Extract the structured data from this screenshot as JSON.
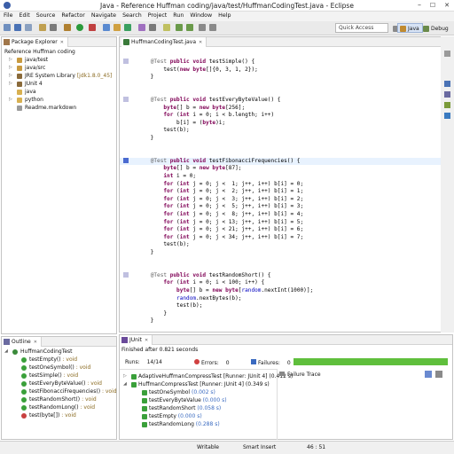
{
  "window": {
    "title": "Java - Reference Huffman coding/java/test/HuffmanCodingTest.java - Eclipse",
    "minimize": "–",
    "maximize": "☐",
    "close": "✕"
  },
  "menu": [
    "File",
    "Edit",
    "Source",
    "Refactor",
    "Navigate",
    "Search",
    "Project",
    "Run",
    "Window",
    "Help"
  ],
  "toolbar": {
    "quick_access": "Quick Access",
    "perspectives": [
      "Java",
      "Debug"
    ]
  },
  "package_explorer": {
    "tab": "Package Explorer",
    "project": "Reference Huffman coding",
    "items": [
      {
        "label": "java/test",
        "icon": "source-folder-icon",
        "arrow": "▷"
      },
      {
        "label": "java/src",
        "icon": "source-folder-icon",
        "arrow": "▷"
      },
      {
        "label": "JRE System Library",
        "suffix": "[jdk1.8.0_45]",
        "icon": "library-icon",
        "arrow": "▷"
      },
      {
        "label": "JUnit 4",
        "icon": "library-icon",
        "arrow": "▷"
      },
      {
        "label": "java",
        "icon": "folder-icon",
        "arrow": ""
      },
      {
        "label": "python",
        "icon": "folder-icon",
        "arrow": "▷"
      },
      {
        "label": "Readme.markdown",
        "icon": "file-icon",
        "arrow": ""
      }
    ]
  },
  "editor": {
    "tab": "HuffmanCodingTest.java",
    "lines": [
      "    @Test public void testSimple() {",
      "        test(new byte[]{0, 3, 1, 2});",
      "    }",
      "",
      "",
      "    @Test public void testEveryByteValue() {",
      "        byte[] b = new byte[256];",
      "        for (int i = 0; i < b.length; i++)",
      "            b[i] = (byte)i;",
      "        test(b);",
      "    }",
      "",
      "",
      "    @Test public void testFibonacciFrequencies() {",
      "        byte[] b = new byte[87];",
      "        int i = 0;",
      "        for (int j = 0; j <  1; j++, i++) b[i] = 0;",
      "        for (int j = 0; j <  2; j++, i++) b[i] = 1;",
      "        for (int j = 0; j <  3; j++, i++) b[i] = 2;",
      "        for (int j = 0; j <  5; j++, i++) b[i] = 3;",
      "        for (int j = 0; j <  8; j++, i++) b[i] = 4;",
      "        for (int j = 0; j < 13; j++, i++) b[i] = 5;",
      "        for (int j = 0; j < 21; j++, i++) b[i] = 6;",
      "        for (int j = 0; j < 34; j++, i++) b[i] = 7;",
      "        test(b);",
      "    }",
      "",
      "",
      "    @Test public void testRandomShort() {",
      "        for (int i = 0; i < 100; i++) {",
      "            byte[] b = new byte[random.nextInt(1000)];",
      "            random.nextBytes(b);",
      "            test(b);",
      "        }",
      "    }"
    ]
  },
  "outline": {
    "tab": "Outline",
    "class": "HuffmanCodingTest",
    "items": [
      "testEmpty() : void",
      "testOneSymbol() : void",
      "testSimple() : void",
      "testEveryByteValue() : void",
      "testFibonacciFrequencies() : void",
      "testRandomShort() : void",
      "testRandomLong() : void",
      "test(byte[]) : void"
    ]
  },
  "junit": {
    "tab": "JUnit",
    "finished": "Finished after 0.821 seconds",
    "runs_label": "Runs:",
    "runs": "14/14",
    "errors_label": "Errors:",
    "errors": "0",
    "failures_label": "Failures:",
    "failures": "0",
    "bar_color": "#5fbf3c",
    "progress": 1.0,
    "failure_trace": "Failure Trace",
    "tests": [
      {
        "label": "AdaptiveHuffmanCompressTest [Runner: JUnit 4] (0.412 s)",
        "level": 0,
        "arrow": "▷"
      },
      {
        "label": "HuffmanCompressTest [Runner: JUnit 4] (0.349 s)",
        "level": 0,
        "arrow": "◢"
      },
      {
        "label": "testOneSymbol (0.002 s)",
        "level": 1,
        "arrow": ""
      },
      {
        "label": "testEveryByteValue (0.000 s)",
        "level": 1,
        "arrow": ""
      },
      {
        "label": "testRandomShort (0.058 s)",
        "level": 1,
        "arrow": ""
      },
      {
        "label": "testEmpty (0.000 s)",
        "level": 1,
        "arrow": ""
      },
      {
        "label": "testRandomLong (0.288 s)",
        "level": 1,
        "arrow": ""
      }
    ]
  },
  "status": {
    "writable": "Writable",
    "insert": "Smart Insert",
    "position": "46 : 51"
  }
}
